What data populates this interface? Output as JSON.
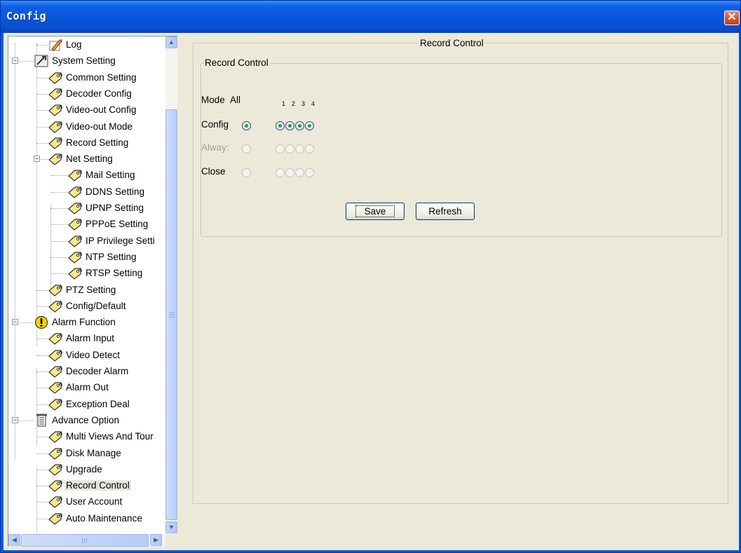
{
  "window": {
    "title": "Config",
    "close_glyph": "✕"
  },
  "colors": {
    "titlebar": "#0a55d9",
    "radio_check": "#21a121",
    "close": "#d9532f"
  },
  "tree": {
    "items": [
      {
        "label": "Log",
        "icon": "log-icon"
      },
      {
        "label": "System Setting",
        "icon": "system-setting-icon"
      },
      {
        "label": "Common Setting",
        "icon": "config-item-icon"
      },
      {
        "label": "Decoder Config",
        "icon": "config-item-icon"
      },
      {
        "label": "Video-out Config",
        "icon": "config-item-icon"
      },
      {
        "label": "Video-out Mode",
        "icon": "config-item-icon"
      },
      {
        "label": "Record Setting",
        "icon": "config-item-icon"
      },
      {
        "label": "Net Setting",
        "icon": "config-item-icon"
      },
      {
        "label": "Mail Setting",
        "icon": "config-item-icon"
      },
      {
        "label": "DDNS Setting",
        "icon": "config-item-icon"
      },
      {
        "label": "UPNP Setting",
        "icon": "config-item-icon"
      },
      {
        "label": "PPPoE Setting",
        "icon": "config-item-icon"
      },
      {
        "label": "IP Privilege Setti",
        "icon": "config-item-icon"
      },
      {
        "label": "NTP Setting",
        "icon": "config-item-icon"
      },
      {
        "label": "RTSP Setting",
        "icon": "config-item-icon"
      },
      {
        "label": "PTZ Setting",
        "icon": "config-item-icon"
      },
      {
        "label": "Config/Default",
        "icon": "config-item-icon"
      },
      {
        "label": "Alarm Function",
        "icon": "alarm-function-icon"
      },
      {
        "label": "Alarm Input",
        "icon": "config-item-icon"
      },
      {
        "label": "Video Detect",
        "icon": "config-item-icon"
      },
      {
        "label": "Decoder Alarm",
        "icon": "config-item-icon"
      },
      {
        "label": "Alarm Out",
        "icon": "config-item-icon"
      },
      {
        "label": "Exception Deal",
        "icon": "config-item-icon"
      },
      {
        "label": "Advance Option",
        "icon": "advance-option-icon"
      },
      {
        "label": "Multi Views And Tour",
        "icon": "config-item-icon"
      },
      {
        "label": "Disk Manage",
        "icon": "config-item-icon"
      },
      {
        "label": "Upgrade",
        "icon": "config-item-icon"
      },
      {
        "label": "Record Control",
        "icon": "config-item-icon"
      },
      {
        "label": "User Account",
        "icon": "config-item-icon"
      },
      {
        "label": "Auto Maintenance",
        "icon": "config-item-icon"
      }
    ],
    "selected": "Record Control",
    "expander_minus": "−"
  },
  "scroll": {
    "up": "▲",
    "down": "▼",
    "left": "◀",
    "right": "▶"
  },
  "record_control": {
    "group_title": "Record Control",
    "inner_title": "Record Control",
    "mode_label": "Mode",
    "all_label": "All",
    "channels": [
      "1",
      "2",
      "3",
      "4"
    ],
    "rows": [
      {
        "label": "Config",
        "all_checked": true,
        "channels_checked": [
          true,
          true,
          true,
          true
        ],
        "enabled": true
      },
      {
        "label": "Alway:",
        "all_checked": false,
        "channels_checked": [
          false,
          false,
          false,
          false
        ],
        "enabled": false
      },
      {
        "label": "Close",
        "all_checked": false,
        "channels_checked": [
          false,
          false,
          false,
          false
        ],
        "enabled": false
      }
    ],
    "save_label": "Save",
    "refresh_label": "Refresh"
  }
}
